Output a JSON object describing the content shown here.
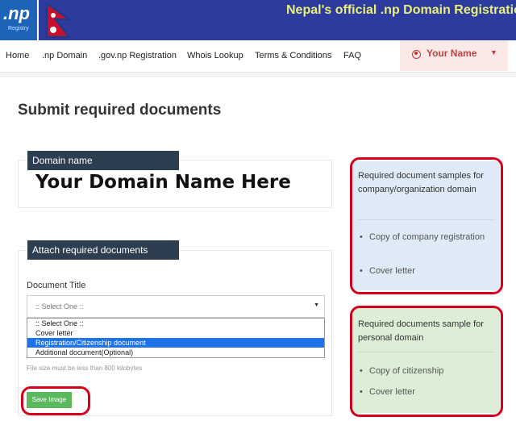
{
  "header": {
    "logo": ".np",
    "logo_sub": "Registry",
    "title": "Nepal's official .np Domain Registration"
  },
  "nav": {
    "items": [
      ".np Domain",
      ".gov.np Registration",
      "Whois Lookup",
      "Terms & Conditions",
      "FAQ"
    ],
    "home": "Home",
    "user_name": "Your Name",
    "user_icon": "user-circle-icon",
    "caret_icon": "caret-down-icon"
  },
  "main": {
    "page_title": "Submit required documents",
    "domain_panel": {
      "label": "Domain name",
      "value": "Your Domain Name Here"
    },
    "attach_panel": {
      "label": "Attach required documents",
      "doc_title_label": "Document Title",
      "select": {
        "selected": ":: Select One ::",
        "options": [
          ":: Select One ::",
          "Cover letter",
          "Registration/Citizenship document",
          "Additional document(Optional)"
        ],
        "highlighted_index": 2
      },
      "hint": "File size must be less than 800 kilobytes",
      "save_label": "Save Image"
    }
  },
  "sidebar": {
    "company": {
      "heading": "Required document samples for company/organization domain",
      "items": [
        "Copy of company registration",
        "Cover letter"
      ]
    },
    "personal": {
      "heading": "Required documents sample for personal domain",
      "items": [
        "Copy of citizenship",
        "Cover letter"
      ]
    }
  },
  "colors": {
    "banner": "#2e3b9e",
    "banner_title": "#e8f07a",
    "panel_tag": "#2c3e50",
    "highlight_ring": "#d6001c",
    "save_button": "#5cb85c",
    "side_blue": "#deebf7",
    "side_green": "#dcefd6",
    "option_selected": "#1e73e8"
  }
}
